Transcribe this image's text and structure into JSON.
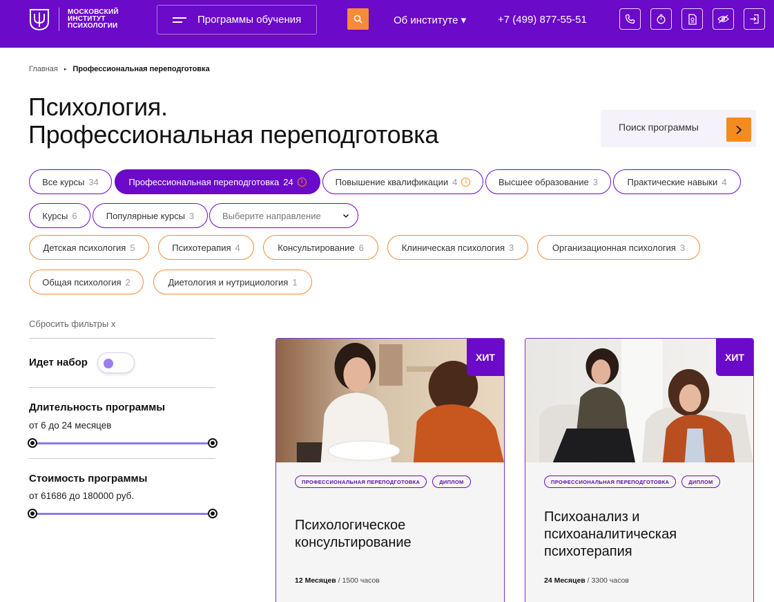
{
  "header": {
    "logo_lines": [
      "МОСКОВСКИЙ",
      "ИНСТИТУТ",
      "ПСИХОЛОГИИ"
    ],
    "programs_button": "Программы обучения",
    "about": "Об институте ▾",
    "phone": "+7 (499) 877-55-51",
    "icons": [
      "phone-icon",
      "timer-icon",
      "document-icon",
      "low-vision-icon",
      "login-icon"
    ],
    "accent": "#6b0ac9",
    "orange": "#f58b3a"
  },
  "breadcrumb": {
    "home": "Главная",
    "separator": "▸",
    "current": "Профессиональная переподготовка"
  },
  "title": {
    "line1": "Психология.",
    "line2": "Профессиональная переподготовка"
  },
  "search": {
    "placeholder": "Поиск программы"
  },
  "types": [
    {
      "label": "Все курсы",
      "count": "34"
    },
    {
      "label": "Профессиональная переподготовка",
      "count": "24",
      "active": true
    },
    {
      "label": "Повышение квалификации",
      "count": "4"
    },
    {
      "label": "Высшее образование",
      "count": "3"
    },
    {
      "label": "Практические навыки",
      "count": "4"
    },
    {
      "label": "Курсы",
      "count": "6"
    },
    {
      "label": "Популярные курсы",
      "count": "3"
    }
  ],
  "direction_select": {
    "value": "Выберите направление"
  },
  "directions": [
    {
      "label": "Детская психология",
      "count": "5"
    },
    {
      "label": "Психотерапия",
      "count": "4"
    },
    {
      "label": "Консультирование",
      "count": "6"
    },
    {
      "label": "Клиническая психология",
      "count": "3"
    },
    {
      "label": "Организационная психология",
      "count": "3"
    },
    {
      "label": "Общая психология",
      "count": "2"
    },
    {
      "label": "Диетология и нутрициология",
      "count": "1"
    }
  ],
  "filters": {
    "reset": "Сбросить фильтры х",
    "enrolling": {
      "label": "Идет набор",
      "on": false
    },
    "duration": {
      "label": "Длительность программы",
      "range_text": "от 6 до 24 месяцев",
      "min": 6,
      "max": 24
    },
    "price": {
      "label": "Стоимость программы",
      "range_text": "от 61686 до 180000 руб.",
      "min": 61686,
      "max": 180000
    }
  },
  "cards": [
    {
      "badge": "ХИТ",
      "tags": [
        "ПРОФЕССИОНАЛЬНАЯ ПЕРЕПОДГОТОВКА",
        "ДИПЛОМ"
      ],
      "title_lines": [
        "Психологическое",
        "консультирование"
      ],
      "duration": "12 Месяцев",
      "hours": " / 1500 часов"
    },
    {
      "badge": "ХИТ",
      "tags": [
        "ПРОФЕССИОНАЛЬНАЯ ПЕРЕПОДГОТОВКА",
        "ДИПЛОМ"
      ],
      "title_lines": [
        "Психоанализ и",
        "психоаналитическая",
        "психотерапия"
      ],
      "duration": "24 Месяцев",
      "hours": " / 3300 часов"
    }
  ]
}
